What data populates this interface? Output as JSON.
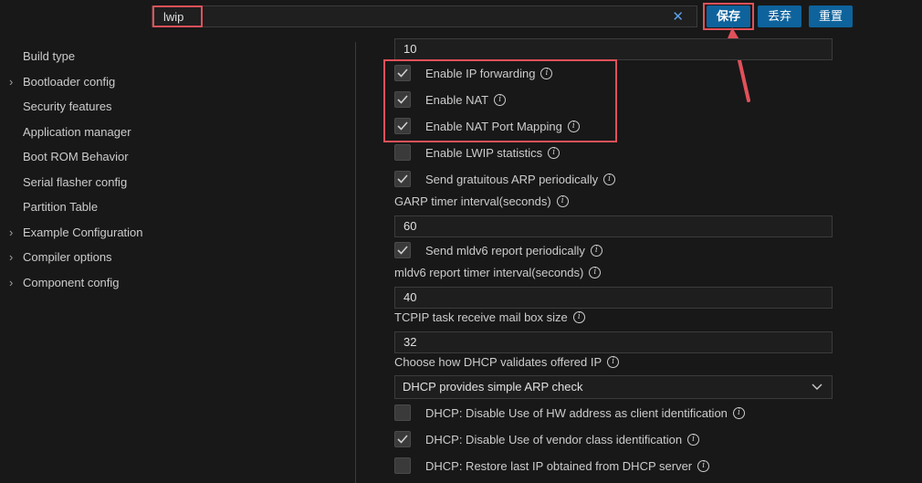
{
  "search": {
    "value": "lwip",
    "clear_icon": "close-icon"
  },
  "toolbar": {
    "save_label": "保存",
    "discard_label": "丢弃",
    "reset_label": "重置"
  },
  "sidebar": {
    "items": [
      {
        "label": "Build type",
        "expandable": false
      },
      {
        "label": "Bootloader config",
        "expandable": true
      },
      {
        "label": "Security features",
        "expandable": false
      },
      {
        "label": "Application manager",
        "expandable": false
      },
      {
        "label": "Boot ROM Behavior",
        "expandable": false
      },
      {
        "label": "Serial flasher config",
        "expandable": false
      },
      {
        "label": "Partition Table",
        "expandable": false
      },
      {
        "label": "Example Configuration",
        "expandable": true
      },
      {
        "label": "Compiler options",
        "expandable": true
      },
      {
        "label": "Component config",
        "expandable": true
      }
    ]
  },
  "settings": {
    "top_value": "10",
    "ip_forwarding": {
      "label": "Enable IP forwarding",
      "checked": true
    },
    "nat": {
      "label": "Enable NAT",
      "checked": true
    },
    "nat_port_mapping": {
      "label": "Enable NAT Port Mapping",
      "checked": true
    },
    "lwip_stats": {
      "label": "Enable LWIP statistics",
      "checked": false
    },
    "garp": {
      "label": "Send gratuitous ARP periodically",
      "checked": true
    },
    "garp_interval_label": "GARP timer interval(seconds)",
    "garp_interval_value": "60",
    "mldv6": {
      "label": "Send mldv6 report periodically",
      "checked": true
    },
    "mldv6_interval_label": "mldv6 report timer interval(seconds)",
    "mldv6_interval_value": "40",
    "tcpip_mbox_label": "TCPIP task receive mail box size",
    "tcpip_mbox_value": "32",
    "dhcp_validate_label": "Choose how DHCP validates offered IP",
    "dhcp_validate_value": "DHCP provides simple ARP check",
    "dhcp_hw_addr": {
      "label": "DHCP: Disable Use of HW address as client identification",
      "checked": false
    },
    "dhcp_vendor": {
      "label": "DHCP: Disable Use of vendor class identification",
      "checked": true
    },
    "dhcp_restore": {
      "label": "DHCP: Restore last IP obtained from DHCP server",
      "checked": false
    }
  },
  "colors": {
    "accent": "#0e639c",
    "highlight": "#e0515a",
    "background": "#181818"
  }
}
